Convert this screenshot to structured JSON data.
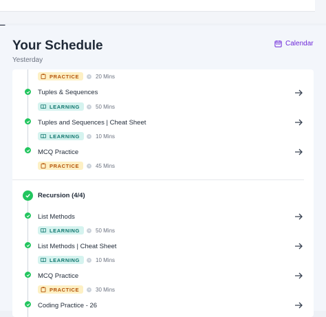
{
  "header": {
    "title": "Your Schedule",
    "subtitle": "Yesterday",
    "calendar_label": "Calendar"
  },
  "colors": {
    "accent": "#6d28d9",
    "success": "#22c55e",
    "practice_bg": "#fdf0c4",
    "learning_bg": "#d5f3ef"
  },
  "group1": {
    "items": [
      {
        "title": "",
        "badge": "PRACTICE",
        "duration": "20 Mins"
      },
      {
        "title": "Tuples & Sequences",
        "badge": "LEARNING",
        "duration": "50 Mins"
      },
      {
        "title": "Tuples and Sequences | Cheat Sheet",
        "badge": "LEARNING",
        "duration": "10 Mins"
      },
      {
        "title": "MCQ Practice",
        "badge": "PRACTICE",
        "duration": "45 Mins"
      }
    ]
  },
  "group2": {
    "title": "Recursion (4/4)",
    "items": [
      {
        "title": "List Methods",
        "badge": "LEARNING",
        "duration": "50 Mins"
      },
      {
        "title": "List Methods | Cheat Sheet",
        "badge": "LEARNING",
        "duration": "10 Mins"
      },
      {
        "title": "MCQ Practice",
        "badge": "PRACTICE",
        "duration": "30 Mins"
      },
      {
        "title": "Coding Practice - 26",
        "badge": "",
        "duration": ""
      }
    ]
  }
}
